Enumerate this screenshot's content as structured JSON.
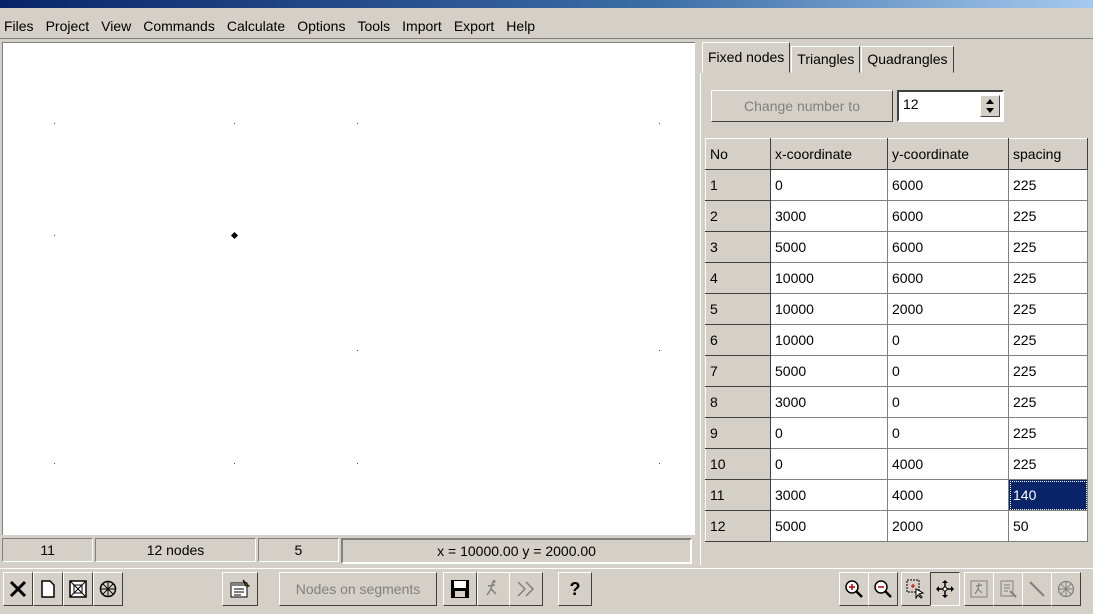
{
  "menu": [
    "Files",
    "Project",
    "View",
    "Commands",
    "Calculate",
    "Options",
    "Tools",
    "Import",
    "Export",
    "Help"
  ],
  "tabs": [
    "Fixed nodes",
    "Triangles",
    "Quadrangles"
  ],
  "change_button": "Change number to",
  "node_count_value": "12",
  "table": {
    "headers": [
      "No",
      "x-coordinate",
      "y-coordinate",
      "spacing"
    ],
    "rows": [
      [
        "1",
        "0",
        "6000",
        "225"
      ],
      [
        "2",
        "3000",
        "6000",
        "225"
      ],
      [
        "3",
        "5000",
        "6000",
        "225"
      ],
      [
        "4",
        "10000",
        "6000",
        "225"
      ],
      [
        "5",
        "10000",
        "2000",
        "225"
      ],
      [
        "6",
        "10000",
        "0",
        "225"
      ],
      [
        "7",
        "5000",
        "0",
        "225"
      ],
      [
        "8",
        "3000",
        "0",
        "225"
      ],
      [
        "9",
        "0",
        "0",
        "225"
      ],
      [
        "10",
        "0",
        "4000",
        "225"
      ],
      [
        "11",
        "3000",
        "4000",
        "140"
      ],
      [
        "12",
        "5000",
        "2000",
        "50"
      ]
    ]
  },
  "status": {
    "selected": "11",
    "nodes": "12 nodes",
    "count": "5",
    "coords": "x = 10000.00  y = 2000.00"
  },
  "toolbar": {
    "nodes_on_segments": "Nodes on segments",
    "help": "?"
  }
}
